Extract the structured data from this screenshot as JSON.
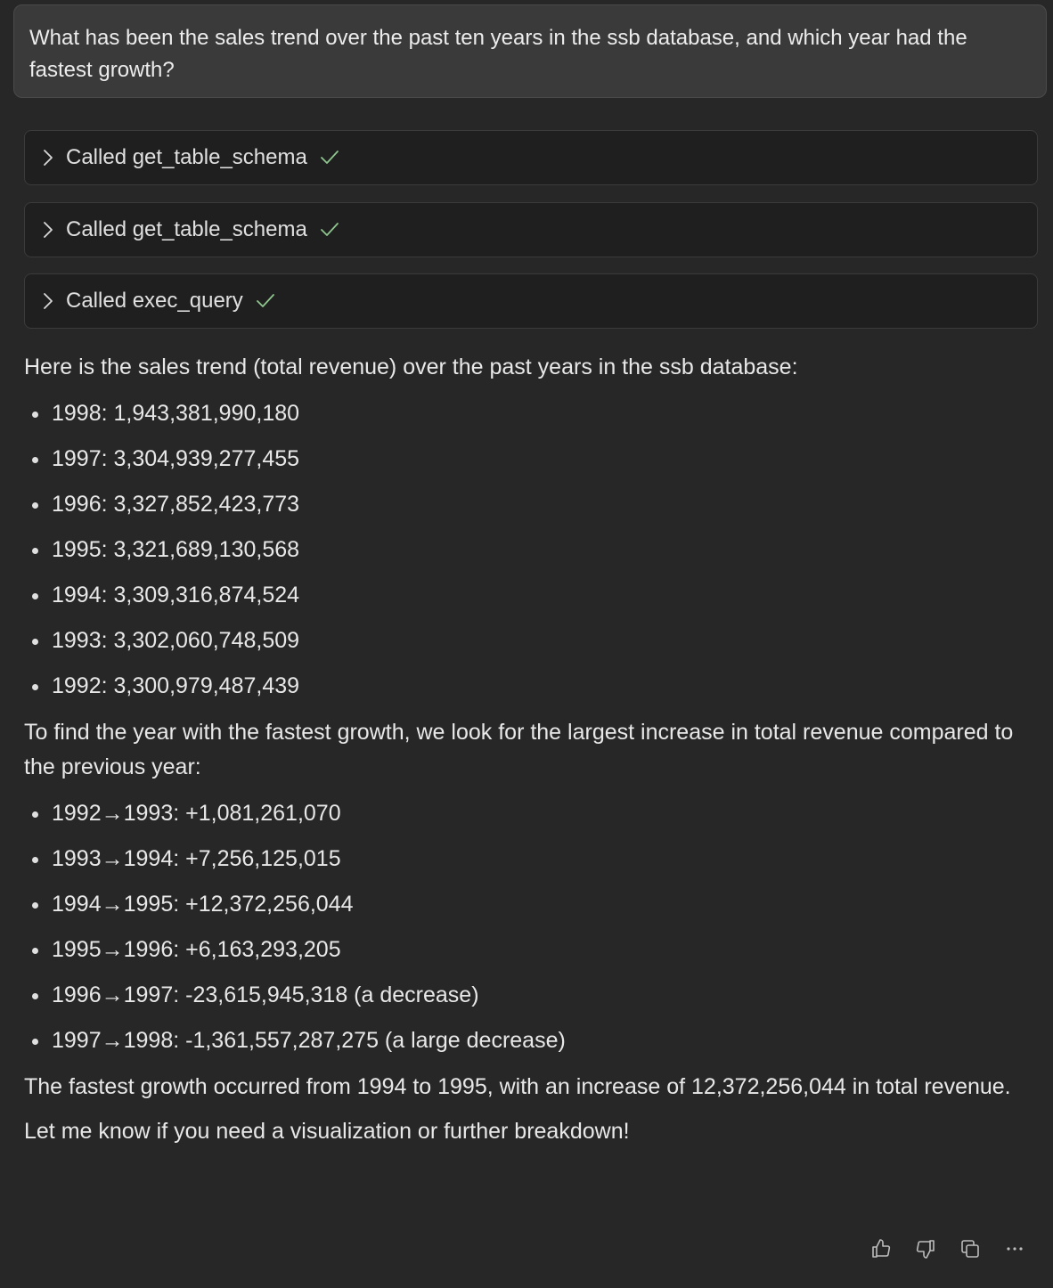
{
  "user_message": "What has been the sales trend over the past ten years in the ssb database, and which year had the fastest growth?",
  "tool_calls": [
    {
      "label": "Called get_table_schema",
      "icon": "chevron-right-icon",
      "status_icon": "check-icon"
    },
    {
      "label": "Called get_table_schema",
      "icon": "chevron-right-icon",
      "status_icon": "check-icon"
    },
    {
      "label": "Called exec_query",
      "icon": "chevron-right-icon",
      "status_icon": "check-icon"
    }
  ],
  "answer": {
    "intro": "Here is the sales trend (total revenue) over the past years in the ssb database:",
    "revenue_by_year": [
      "1998: 1,943,381,990,180",
      "1997: 3,304,939,277,455",
      "1996: 3,327,852,423,773",
      "1995: 3,321,689,130,568",
      "1994: 3,309,316,874,524",
      "1993: 3,302,060,748,509",
      "1992: 3,300,979,487,439"
    ],
    "growth_intro": "To find the year with the fastest growth, we look for the largest increase in total revenue compared to the previous year:",
    "growth_items": [
      "1992→1993: +1,081,261,070",
      "1993→1994: +7,256,125,015",
      "1994→1995: +12,372,256,044",
      "1995→1996: +6,163,293,205",
      "1996→1997: -23,615,945,318 (a decrease)",
      "1997→1998: -1,361,557,287,275 (a large decrease)"
    ],
    "conclusion": "The fastest growth occurred from 1994 to 1995, with an increase of 12,372,256,044 in total revenue.",
    "closing": "Let me know if you need a visualization or further breakdown!"
  },
  "footer_actions": [
    "thumbs-up-icon",
    "thumbs-down-icon",
    "copy-icon",
    "more-icon"
  ],
  "colors": {
    "background": "#272727",
    "user_bubble": "#3a3a3a",
    "tool_call_bg": "#1f1f1f",
    "check_green": "#8fc58f"
  }
}
